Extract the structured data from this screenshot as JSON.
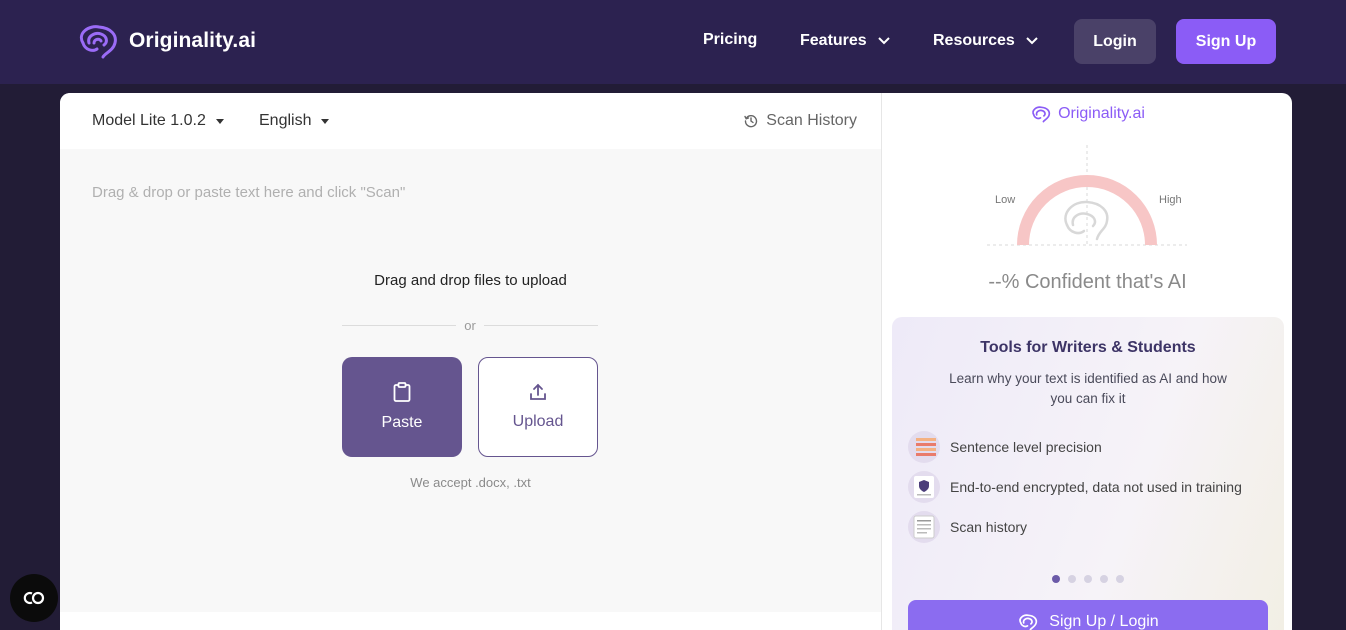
{
  "nav": {
    "brand": "Originality.ai",
    "links": [
      {
        "label": "Pricing"
      },
      {
        "label": "Features"
      },
      {
        "label": "Resources"
      }
    ],
    "login_label": "Login",
    "signup_label": "Sign Up"
  },
  "editor": {
    "model_select": "Model Lite 1.0.2",
    "language_select": "English",
    "scan_history_label": "Scan History",
    "placeholder": "Drag & drop or paste text here and click \"Scan\"",
    "drop_title": "Drag and drop files to upload",
    "or_label": "or",
    "paste_label": "Paste",
    "upload_label": "Upload",
    "accept_note": "We accept .docx, .txt"
  },
  "result": {
    "brand": "Originality.ai",
    "gauge_low": "Low",
    "gauge_high": "High",
    "confidence_text": "--% Confident that's AI"
  },
  "promo": {
    "title": "Tools for Writers & Students",
    "description": "Learn why your text is identified as AI and how you can fix it",
    "features": [
      {
        "label": "Sentence level precision",
        "icon": "sentence-highlight-thumb"
      },
      {
        "label": "End-to-end encrypted, data not used in training",
        "icon": "encryption-shield-thumb"
      },
      {
        "label": "Scan history",
        "icon": "scan-history-thumb"
      }
    ],
    "carousel_count": 5,
    "carousel_active": 0,
    "cta_label": "Sign Up / Login"
  },
  "colors": {
    "nav_bg": "#2c2250",
    "page_bg": "#221c36",
    "accent": "#8b5cf6",
    "paste_bg": "#65558f",
    "gauge_arc": "#f7c6c6"
  }
}
